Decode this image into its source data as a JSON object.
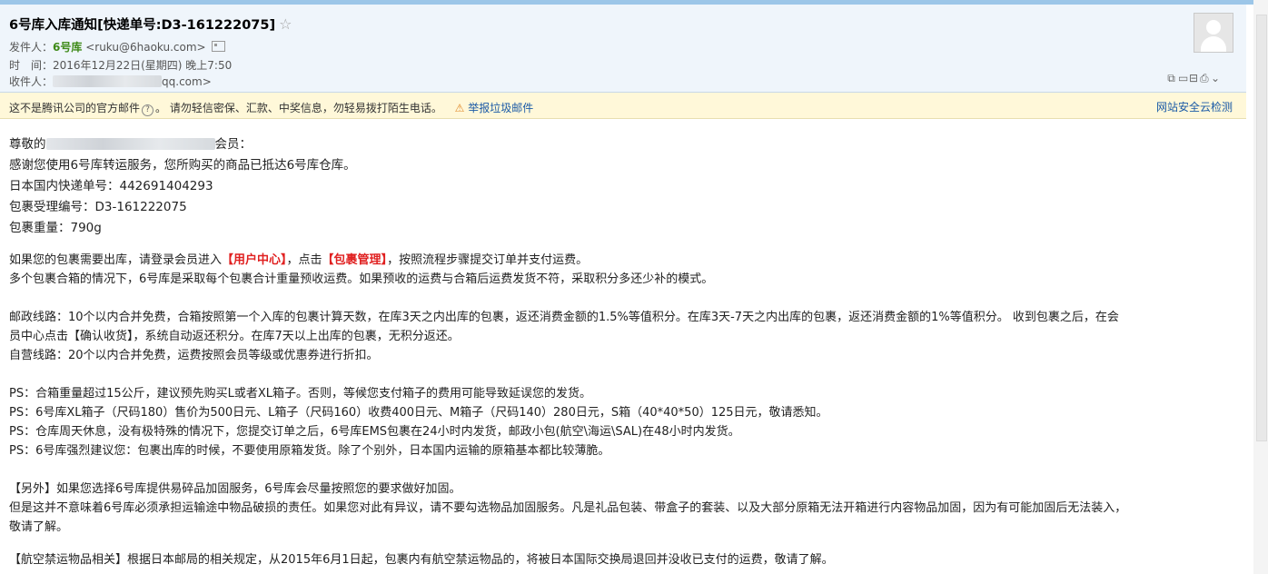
{
  "email": {
    "subject": "6号库入库通知[快递单号:D3-161222075]",
    "star": "☆",
    "from_label": "发件人：",
    "from_name": "6号库",
    "from_email": "<ruku@6haoku.com>",
    "time_label": "时　间：",
    "time_value": "2016年12月22日(星期四) 晚上7:50",
    "to_label": "收件人：",
    "to_suffix": "qq.com>"
  },
  "toolbar_icons": [
    "new-window-icon",
    "print-preview-icon",
    "save-icon",
    "print-icon",
    "chevron-down-icon"
  ],
  "notice": {
    "text1": "这不是腾讯公司的官方邮件",
    "qmark": "?",
    "text2": "。 请勿轻信密保、汇款、中奖信息，勿轻易拨打陌生电话。",
    "report_link": "举报垃圾邮件",
    "right_link": "网站安全云检测"
  },
  "body": {
    "greeting_pre": "尊敬的",
    "greeting_post": "会员：",
    "thanks": "感谢您使用6号库转运服务，您所购买的商品已抵达6号库仓库。",
    "tracking": "日本国内快递单号：442691404293",
    "parcel_no": "包裹受理编号：D3-161222075",
    "weight": "包裹重量：790g",
    "p1_a": "如果您的包裹需要出库，请登录会员进入",
    "p1_b": "【用户中心】",
    "p1_c": "，点击",
    "p1_d": "【包裹管理】",
    "p1_e": "，按照流程步骤提交订单并支付运费。",
    "p2": "多个包裹合箱的情况下，6号库是采取每个包裹合计重量预收运费。如果预收的运费与合箱后运费发货不符，采取积分多还少补的模式。",
    "p3": "邮政线路：10个以内合并免费，合箱按照第一个入库的包裹计算天数，在库3天之内出库的包裹，返还消费金额的1.5%等值积分。在库3天-7天之内出库的包裹，返还消费金额的1%等值积分。 收到包裹之后，在会",
    "p4": "员中心点击【确认收货】，系统自动返还积分。在库7天以上出库的包裹，无积分返还。",
    "p5": "自营线路：20个以内合并免费，运费按照会员等级或优惠券进行折扣。",
    "ps1": "PS：合箱重量超过15公斤，建议预先购买L或者XL箱子。否则，等候您支付箱子的费用可能导致延误您的发货。",
    "ps2": "PS：6号库XL箱子（尺码180）售价为500日元、L箱子（尺码160）收费400日元、M箱子（尺码140）280日元，S箱（40*40*50）125日元，敬请悉知。",
    "ps3": "PS：仓库周天休息，没有极特殊的情况下，您提交订单之后，6号库EMS包裹在24小时内发货，邮政小包(航空\\海运\\SAL)在48小时内发货。",
    "ps4": "PS：6号库强烈建议您：包裹出库的时候，不要使用原箱发货。除了个别外，日本国内运输的原箱基本都比较薄脆。",
    "extra1": "【另外】如果您选择6号库提供易碎品加固服务，6号库会尽量按照您的要求做好加固。",
    "extra2": "但是这并不意味着6号库必须承担运输途中物品破损的责任。如果您对此有异议，请不要勾选物品加固服务。凡是礼品包装、带盒子的套装、以及大部分原箱无法开箱进行内容物品加固，因为有可能加固后无法装入，",
    "extra3": "敬请了解。",
    "air": "【航空禁运物品相关】根据日本邮局的相关规定，从2015年6月1日起，包裹内有航空禁运物品的，将被日本国际交换局退回并没收已支付的运费，敬请了解。"
  },
  "colors": {
    "accent_red": "#e02020",
    "sender_green": "#3e8a18",
    "link_blue": "#1a5aa6",
    "notice_bg": "#fff8d9",
    "header_bg": "#eff5fb"
  }
}
